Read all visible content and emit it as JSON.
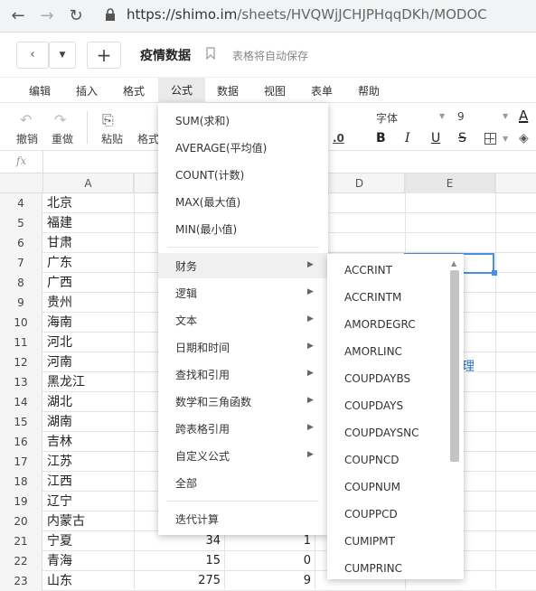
{
  "browser": {
    "url_host": "https://shimo.im",
    "url_path": "/sheets/HVQWjJCHJPHqqDKh/MODOC"
  },
  "doc": {
    "title": "疫情数据",
    "autosave": "表格将自动保存"
  },
  "menubar": {
    "items": [
      "编辑",
      "插入",
      "格式",
      "公式",
      "数据",
      "视图",
      "表单",
      "帮助"
    ]
  },
  "toolbar": {
    "undo": "撤销",
    "redo": "重做",
    "paste": "粘贴",
    "format": "格式",
    "font": "字体",
    "size": "9",
    "bold": "B",
    "italic": "I",
    "underline": "U",
    "strike": "S",
    "decimal": ".0"
  },
  "formula_bar": {
    "fx": "fx"
  },
  "columns": [
    "A",
    "D",
    "E"
  ],
  "rows": [
    {
      "n": "4",
      "a": "北京",
      "b": "",
      "c": ""
    },
    {
      "n": "5",
      "a": "福建",
      "b": "",
      "c": ""
    },
    {
      "n": "6",
      "a": "甘肃",
      "b": "",
      "c": ""
    },
    {
      "n": "7",
      "a": "广东",
      "b": "",
      "c": ""
    },
    {
      "n": "8",
      "a": "广西",
      "b": "",
      "c": ""
    },
    {
      "n": "9",
      "a": "贵州",
      "b": "",
      "c": ""
    },
    {
      "n": "10",
      "a": "海南",
      "b": "",
      "c": ""
    },
    {
      "n": "11",
      "a": "河北",
      "b": "",
      "c": ""
    },
    {
      "n": "12",
      "a": "河南",
      "b": "",
      "c": ""
    },
    {
      "n": "13",
      "a": "黑龙江",
      "b": "",
      "c": ""
    },
    {
      "n": "14",
      "a": "湖北",
      "b": "",
      "c": ""
    },
    {
      "n": "15",
      "a": "湖南",
      "b": "",
      "c": ""
    },
    {
      "n": "16",
      "a": "吉林",
      "b": "",
      "c": ""
    },
    {
      "n": "17",
      "a": "江苏",
      "b": "",
      "c": ""
    },
    {
      "n": "18",
      "a": "江西",
      "b": "",
      "c": ""
    },
    {
      "n": "19",
      "a": "辽宁",
      "b": "",
      "c": ""
    },
    {
      "n": "20",
      "a": "内蒙古",
      "b": "",
      "c": ""
    },
    {
      "n": "21",
      "a": "宁夏",
      "b": "34",
      "c": "1"
    },
    {
      "n": "22",
      "a": "青海",
      "b": "15",
      "c": "0"
    },
    {
      "n": "23",
      "a": "山东",
      "b": "275",
      "c": "9"
    }
  ],
  "cell_fragment": "理",
  "formula_menu": {
    "quick": [
      "SUM(求和)",
      "AVERAGE(平均值)",
      "COUNT(计数)",
      "MAX(最大值)",
      "MIN(最小值)"
    ],
    "categories": [
      "财务",
      "逻辑",
      "文本",
      "日期和时间",
      "查找和引用",
      "数学和三角函数",
      "跨表格引用",
      "自定义公式"
    ],
    "all": "全部",
    "iterative": "迭代计算"
  },
  "finance_submenu": [
    "ACCRINT",
    "ACCRINTM",
    "AMORDEGRC",
    "AMORLINC",
    "COUPDAYBS",
    "COUPDAYS",
    "COUPDAYSNC",
    "COUPNCD",
    "COUPNUM",
    "COUPPCD",
    "CUMIPMT",
    "CUMPRINC"
  ],
  "colors": {
    "accent": "#4a90e2",
    "link": "#2a73c9"
  }
}
